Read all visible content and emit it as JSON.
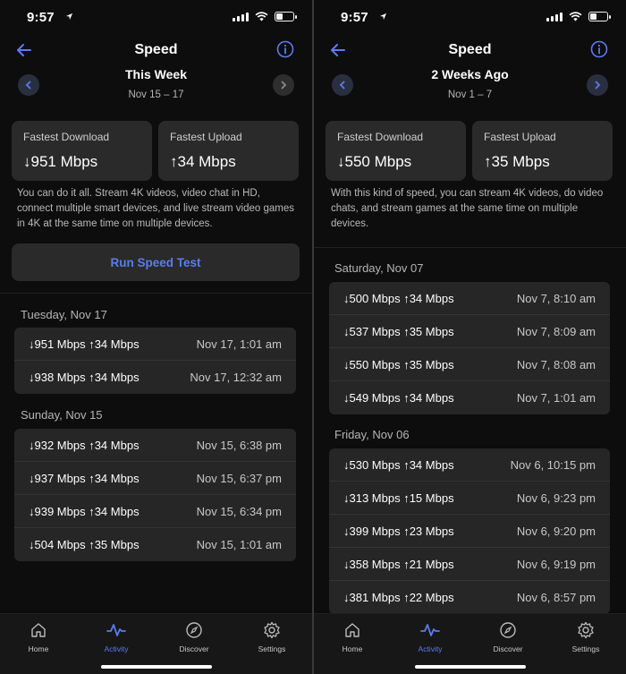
{
  "screens": [
    {
      "status": {
        "time": "9:57"
      },
      "header": {
        "title": "Speed",
        "period": "This Week",
        "range": "Nov 15 – 17"
      },
      "stats": {
        "download_label": "Fastest Download",
        "download_value": "↓951 Mbps",
        "upload_label": "Fastest Upload",
        "upload_value": "↑34 Mbps"
      },
      "description": "You can do it all. Stream 4K videos, video chat in HD, connect multiple smart devices, and live stream video games in 4K at the same time on multiple devices.",
      "run_button": "Run Speed Test",
      "days": [
        {
          "label": "Tuesday, Nov 17",
          "results": [
            {
              "speeds": "↓951 Mbps ↑34 Mbps",
              "when": "Nov 17, 1:01 am"
            },
            {
              "speeds": "↓938 Mbps ↑34 Mbps",
              "when": "Nov 17, 12:32 am"
            }
          ]
        },
        {
          "label": "Sunday, Nov 15",
          "results": [
            {
              "speeds": "↓932 Mbps ↑34 Mbps",
              "when": "Nov 15, 6:38 pm"
            },
            {
              "speeds": "↓937 Mbps ↑34 Mbps",
              "when": "Nov 15, 6:37 pm"
            },
            {
              "speeds": "↓939 Mbps ↑34 Mbps",
              "when": "Nov 15, 6:34 pm"
            },
            {
              "speeds": "↓504 Mbps ↑35 Mbps",
              "when": "Nov 15, 1:01 am"
            }
          ]
        }
      ]
    },
    {
      "status": {
        "time": "9:57"
      },
      "header": {
        "title": "Speed",
        "period": "2 Weeks Ago",
        "range": "Nov 1 – 7"
      },
      "stats": {
        "download_label": "Fastest Download",
        "download_value": "↓550 Mbps",
        "upload_label": "Fastest Upload",
        "upload_value": "↑35 Mbps"
      },
      "description": "With this kind of speed, you can stream 4K videos, do video chats, and stream games at the same time on multiple devices.",
      "days": [
        {
          "label": "Saturday, Nov 07",
          "results": [
            {
              "speeds": "↓500 Mbps ↑34 Mbps",
              "when": "Nov 7, 8:10 am"
            },
            {
              "speeds": "↓537 Mbps ↑35 Mbps",
              "when": "Nov 7, 8:09 am"
            },
            {
              "speeds": "↓550 Mbps ↑35 Mbps",
              "when": "Nov 7, 8:08 am"
            },
            {
              "speeds": "↓549 Mbps ↑34 Mbps",
              "when": "Nov 7, 1:01 am"
            }
          ]
        },
        {
          "label": "Friday, Nov 06",
          "results": [
            {
              "speeds": "↓530 Mbps ↑34 Mbps",
              "when": "Nov 6, 10:15 pm"
            },
            {
              "speeds": "↓313 Mbps ↑15 Mbps",
              "when": "Nov 6, 9:23 pm"
            },
            {
              "speeds": "↓399 Mbps ↑23 Mbps",
              "when": "Nov 6, 9:20 pm"
            },
            {
              "speeds": "↓358 Mbps ↑21 Mbps",
              "when": "Nov 6, 9:19 pm"
            },
            {
              "speeds": "↓381 Mbps ↑22 Mbps",
              "when": "Nov 6, 8:57 pm"
            }
          ]
        }
      ]
    }
  ],
  "tabs": [
    {
      "label": "Home",
      "icon": "home-icon"
    },
    {
      "label": "Activity",
      "icon": "activity-icon",
      "active": true
    },
    {
      "label": "Discover",
      "icon": "compass-icon"
    },
    {
      "label": "Settings",
      "icon": "gear-icon"
    }
  ],
  "colors": {
    "accent": "#5b7cf0",
    "background": "#0d0d0d",
    "card": "#2a2a2a"
  }
}
